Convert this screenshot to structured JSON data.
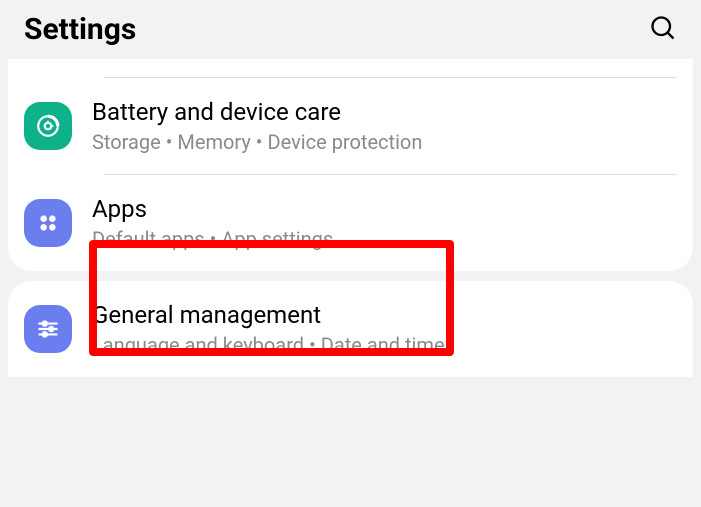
{
  "header": {
    "title": "Settings"
  },
  "items": [
    {
      "icon": "battery-care-icon",
      "title": "Battery and device care",
      "subtitle": "Storage  •  Memory  •  Device protection"
    },
    {
      "icon": "apps-icon",
      "title": "Apps",
      "subtitle": "Default apps  •  App settings"
    },
    {
      "icon": "general-management-icon",
      "title": "General management",
      "subtitle": "Language and keyboard  •  Date and time"
    }
  ]
}
